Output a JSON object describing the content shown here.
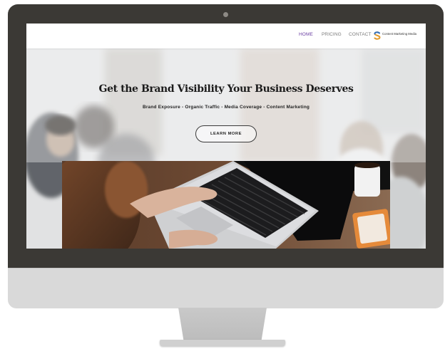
{
  "nav": {
    "items": [
      {
        "label": "HOME",
        "active": true
      },
      {
        "label": "PRICING",
        "active": false
      },
      {
        "label": "CONTACT",
        "active": false
      }
    ],
    "logo_text": "Content Marketing Media",
    "logo_icon": "s-logo-icon"
  },
  "hero": {
    "title": "Get the Brand Visibility Your Business Deserves",
    "subtitle": "Brand Exposure - Organic Traffic - Media Coverage - Content Marketing",
    "cta_label": "LEARN MORE"
  },
  "colors": {
    "accent": "#6b3fa3",
    "monitor_frame": "#3b3935",
    "stand": "#d9d9d9"
  }
}
